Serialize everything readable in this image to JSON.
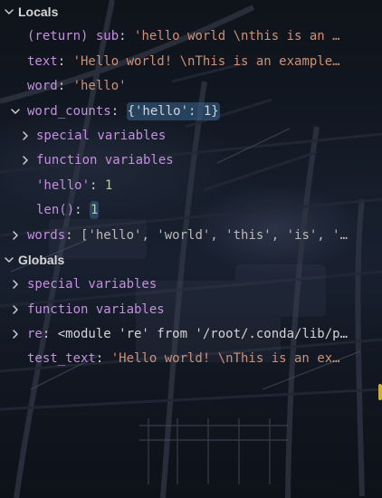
{
  "colors": {
    "background": "#1b1f2a",
    "variable_name": "#c58fe0",
    "string": "#ce9178",
    "number": "#b5cea8",
    "text": "#d4d4d4",
    "highlight": "#355c82"
  },
  "icons": {
    "expanded": "chevron-down-icon",
    "collapsed": "chevron-right-icon"
  },
  "locals": {
    "title": "Locals",
    "items": [
      {
        "name": "(return) sub",
        "value": "'hello world  \\nthis is an …"
      },
      {
        "name": "text",
        "value": "'Hello world!  \\nThis is an example…"
      },
      {
        "name": "word",
        "value": "'hello'"
      },
      {
        "name": "word_counts",
        "value": "{'hello': 1}",
        "children": [
          {
            "label": "special variables"
          },
          {
            "label": "function variables"
          },
          {
            "key": "'hello'",
            "value": "1"
          },
          {
            "key": "len()",
            "value": "1"
          }
        ]
      },
      {
        "name": "words",
        "value": "['hello', 'world', 'this', 'is', '…"
      }
    ]
  },
  "globals": {
    "title": "Globals",
    "items": [
      {
        "label": "special variables"
      },
      {
        "label": "function variables"
      },
      {
        "name": "re",
        "value": "<module 're' from '/root/.conda/lib/p…"
      },
      {
        "name": "test_text",
        "value": "'Hello world!  \\nThis is an ex…"
      }
    ]
  }
}
